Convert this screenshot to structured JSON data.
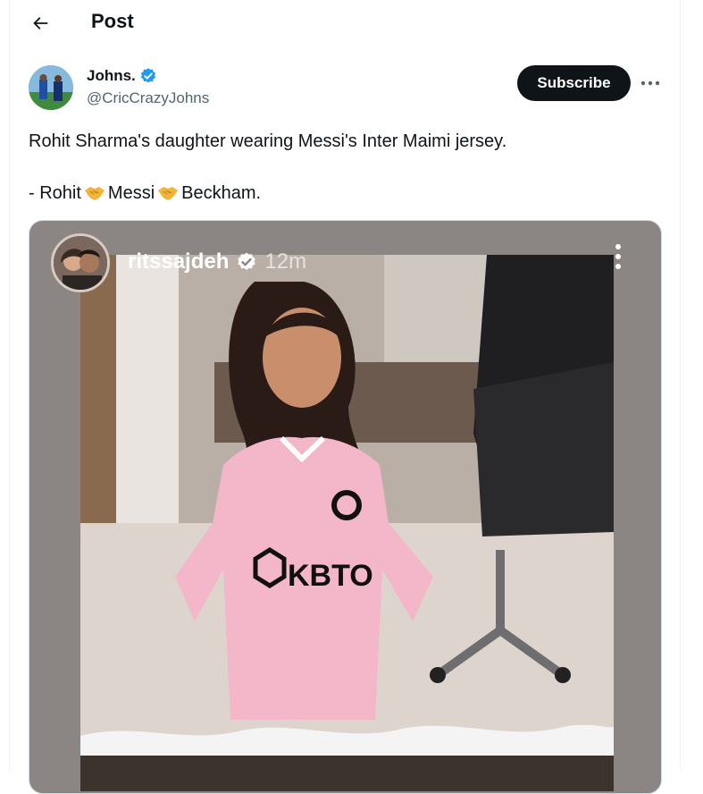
{
  "header": {
    "title": "Post"
  },
  "author": {
    "name": "Johns.",
    "handle": "@CricCrazyJohns"
  },
  "actions": {
    "subscribe_label": "Subscribe"
  },
  "post": {
    "line1": "Rohit Sharma's daughter wearing Messi's Inter Maimi jersey.",
    "line2_parts": [
      "- Rohit",
      "Messi",
      "Beckham."
    ]
  },
  "media": {
    "story_username": "ritssajdeh",
    "story_time": "12m",
    "jersey_text": "KBTO"
  },
  "icons": {
    "back": "arrow-left-icon",
    "verified": "verified-badge-icon",
    "more": "more-horizontal-icon",
    "handshake": "handshake-emoji",
    "story_menu": "more-vertical-icon"
  },
  "colors": {
    "accent": "#1d9bf0",
    "subscribe_bg": "#0f1419",
    "jersey_pink": "#f3b7c9"
  }
}
